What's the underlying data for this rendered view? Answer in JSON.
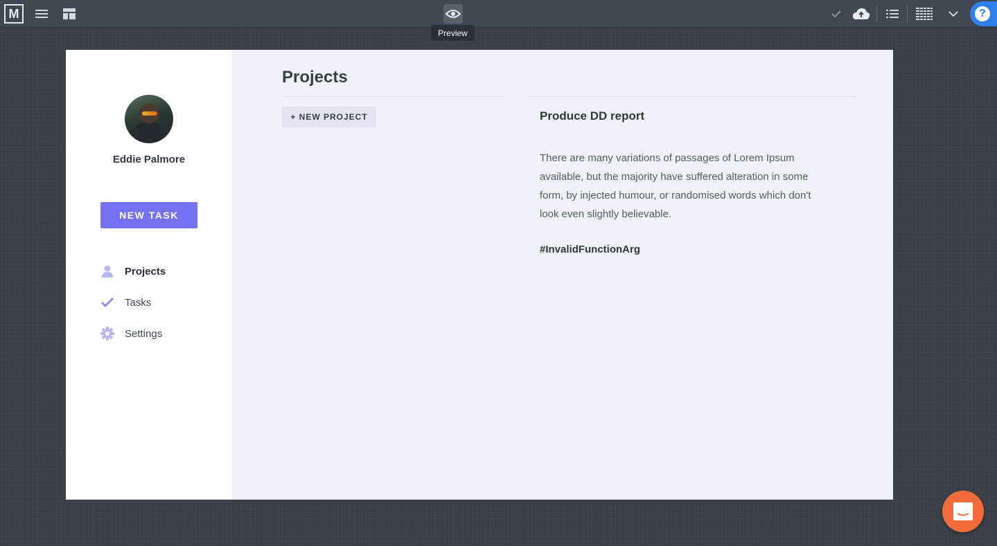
{
  "toolbar": {
    "logo_letter": "M",
    "preview_tooltip": "Preview",
    "help_glyph": "?",
    "icons": [
      "menu-icon",
      "layout-icon",
      "eye-icon",
      "check-icon",
      "cloud-upload-icon",
      "list-icon",
      "grid-icon",
      "chevron-down-icon",
      "help-icon"
    ]
  },
  "sidebar": {
    "user_name": "Eddie Palmore",
    "new_task_label": "NEW TASK",
    "items": [
      {
        "label": "Projects",
        "icon": "user-icon",
        "active": true
      },
      {
        "label": "Tasks",
        "icon": "check-icon",
        "active": false
      },
      {
        "label": "Settings",
        "icon": "gear-icon",
        "active": false
      }
    ]
  },
  "main": {
    "title": "Projects",
    "new_project_label": "+ NEW PROJECT",
    "detail": {
      "title": "Produce DD report",
      "body": "There are many variations of passages of Lorem Ipsum available, but the majority have suffered alteration in some form, by injected humour, or randomised words which don't look even slightly believable.",
      "tag": "#InvalidFunctionArg"
    }
  },
  "colors": {
    "accent": "#7472f2",
    "chat": "#f26b3a",
    "help": "#2f80ed"
  }
}
